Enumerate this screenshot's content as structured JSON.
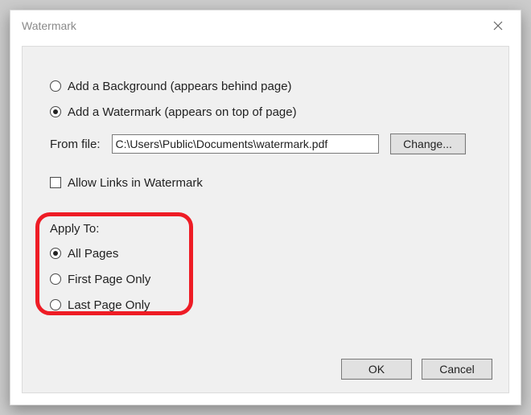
{
  "title": "Watermark",
  "type": {
    "background_label": "Add a Background (appears behind page)",
    "watermark_label": "Add a Watermark (appears on top of page)"
  },
  "file": {
    "label": "From file:",
    "path": "C:\\Users\\Public\\Documents\\watermark.pdf",
    "change_button": "Change..."
  },
  "allow_links_label": "Allow Links in Watermark",
  "apply": {
    "label": "Apply To:",
    "options": {
      "all": "All Pages",
      "first": "First Page Only",
      "last": "Last Page Only"
    }
  },
  "buttons": {
    "ok": "OK",
    "cancel": "Cancel"
  }
}
